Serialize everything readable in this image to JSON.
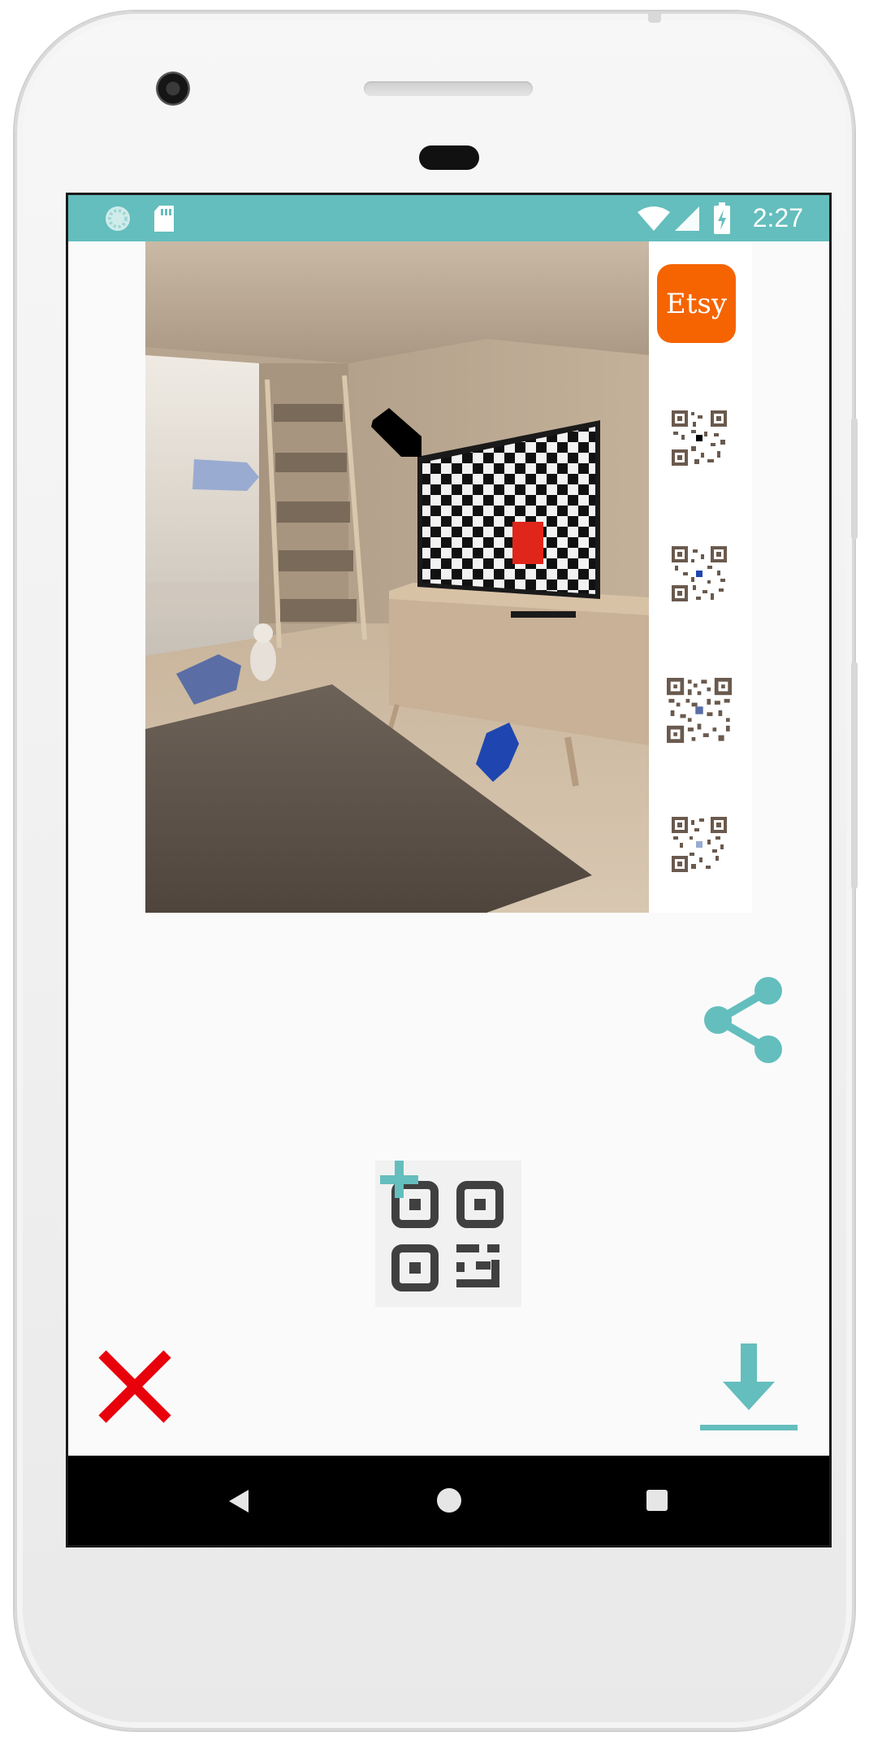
{
  "status_bar": {
    "time": "2:27",
    "icons": [
      "loading-icon",
      "sd-card-icon",
      "wifi-icon",
      "signal-icon",
      "battery-charging-icon"
    ],
    "color": "#64bebd"
  },
  "photo": {
    "description_icon": "room-photo-with-markers",
    "markers": [
      {
        "name": "marker-black",
        "color": "#000000"
      },
      {
        "name": "marker-red",
        "color": "#e0261b"
      },
      {
        "name": "marker-light-blue",
        "color": "#9aabd2"
      },
      {
        "name": "marker-dark-blue",
        "color": "#5a6ea5"
      },
      {
        "name": "marker-blue",
        "color": "#1f46b0"
      }
    ]
  },
  "qr_strip": {
    "etsy_label": "Etsy",
    "etsy_color": "#f56400",
    "qr_codes": [
      {
        "name": "qr-black",
        "dot_color": "#000000"
      },
      {
        "name": "qr-blue",
        "dot_color": "#1f46b0"
      },
      {
        "name": "qr-dark-blue",
        "dot_color": "#5a6ea5"
      },
      {
        "name": "qr-light-blue",
        "dot_color": "#9aabd2"
      }
    ]
  },
  "actions": {
    "share_icon": "share-icon",
    "add_qr_icon": "add-qr-icon",
    "close_icon": "close-icon",
    "download_icon": "download-icon",
    "accent": "#64bebd",
    "close_color": "#e8000b"
  },
  "nav_bar": {
    "back_icon": "back-icon",
    "home_icon": "home-icon",
    "recent_icon": "recent-apps-icon"
  }
}
